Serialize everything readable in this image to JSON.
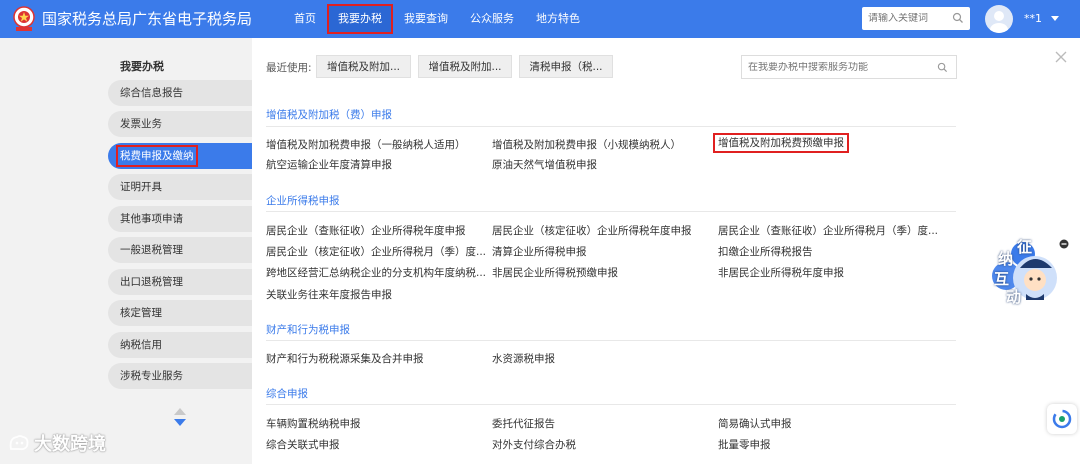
{
  "header": {
    "site_title": "国家税务总局广东省电子税务局",
    "nav": [
      "首页",
      "我要办税",
      "我要查询",
      "公众服务",
      "地方特色"
    ],
    "search_placeholder": "请输入关键词",
    "user_name": "**1"
  },
  "sidebar": {
    "title": "我要办税",
    "items": [
      "综合信息报告",
      "发票业务",
      "税费申报及缴纳",
      "证明开具",
      "其他事项申请",
      "一般退税管理",
      "出口退税管理",
      "核定管理",
      "纳税信用",
      "涉税专业服务"
    ]
  },
  "recent": {
    "label": "最近使用:",
    "items": [
      "增值税及附加...",
      "增值税及附加...",
      "清税申报（税..."
    ]
  },
  "main_search_placeholder": "在我要办税中搜索服务功能",
  "sections": [
    {
      "title": "增值税及附加税（费）申报",
      "items": [
        "增值税及附加税费申报（一般纳税人适用）",
        "增值税及附加税费申报（小规模纳税人）",
        "增值税及附加税费预缴申报",
        "航空运输企业年度清算申报",
        "原油天然气增值税申报"
      ]
    },
    {
      "title": "企业所得税申报",
      "items": [
        "居民企业（查账征收）企业所得税年度申报",
        "居民企业（核定征收）企业所得税年度申报",
        "居民企业（查账征收）企业所得税月（季）度...",
        "居民企业（核定征收）企业所得税月（季）度...",
        "清算企业所得税申报",
        "扣缴企业所得税报告",
        "跨地区经营汇总纳税企业的分支机构年度纳税...",
        "非居民企业所得税预缴申报",
        "非居民企业所得税年度申报",
        "关联业务往来年度报告申报"
      ]
    },
    {
      "title": "财产和行为税申报",
      "items": [
        "财产和行为税税源采集及合并申报",
        "水资源税申报"
      ]
    },
    {
      "title": "综合申报",
      "items": [
        "车辆购置税纳税申报",
        "委托代征报告",
        "简易确认式申报",
        "综合关联式申报",
        "对外支付综合办税",
        "批量零申报"
      ]
    }
  ],
  "float_badge": {
    "chars": [
      "征",
      "纳",
      "互",
      "动"
    ]
  },
  "watermark": "大数跨境",
  "colors": {
    "primary": "#3b7bea",
    "highlight": "#e02020"
  }
}
